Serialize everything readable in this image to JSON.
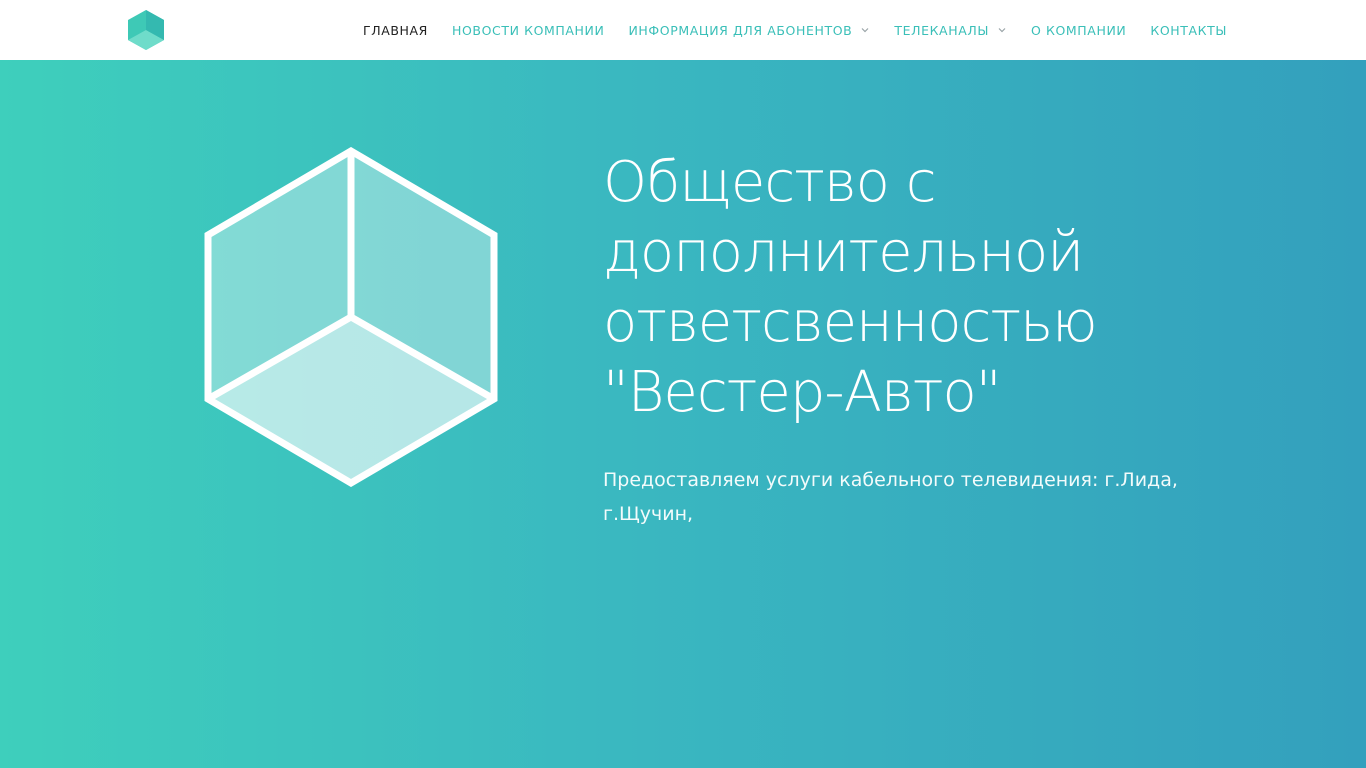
{
  "header": {
    "logo_icon": "hexagon-cube-logo-icon",
    "nav": [
      {
        "label": "ГЛАВНАЯ",
        "active": true
      },
      {
        "label": "НОВОСТИ КОМПАНИИ",
        "active": false
      },
      {
        "label": "ИНФОРМАЦИЯ ДЛЯ АБОНЕНТОВ",
        "active": false,
        "has_dropdown": true
      },
      {
        "label": "ТЕЛЕКАНАЛЫ",
        "active": false,
        "has_dropdown": true
      },
      {
        "label": "О КОМПАНИИ",
        "active": false
      },
      {
        "label": "КОНТАКТЫ",
        "active": false
      }
    ]
  },
  "hero": {
    "icon": "cube-icon",
    "title_lines": [
      "Общество с",
      "дополнительной",
      "ответсвенностью",
      "\"Вестер-Авто\""
    ],
    "subtitle_lines": [
      "Предоставляем услуги кабельного телевидения: г.Лида,",
      "г.Щучин,"
    ]
  },
  "colors": {
    "accent": "#3abfb8",
    "nav_active": "#222222",
    "gradient_start": "#3ecfbc",
    "gradient_end": "#33a0bd",
    "header_bg": "#ffffff"
  }
}
